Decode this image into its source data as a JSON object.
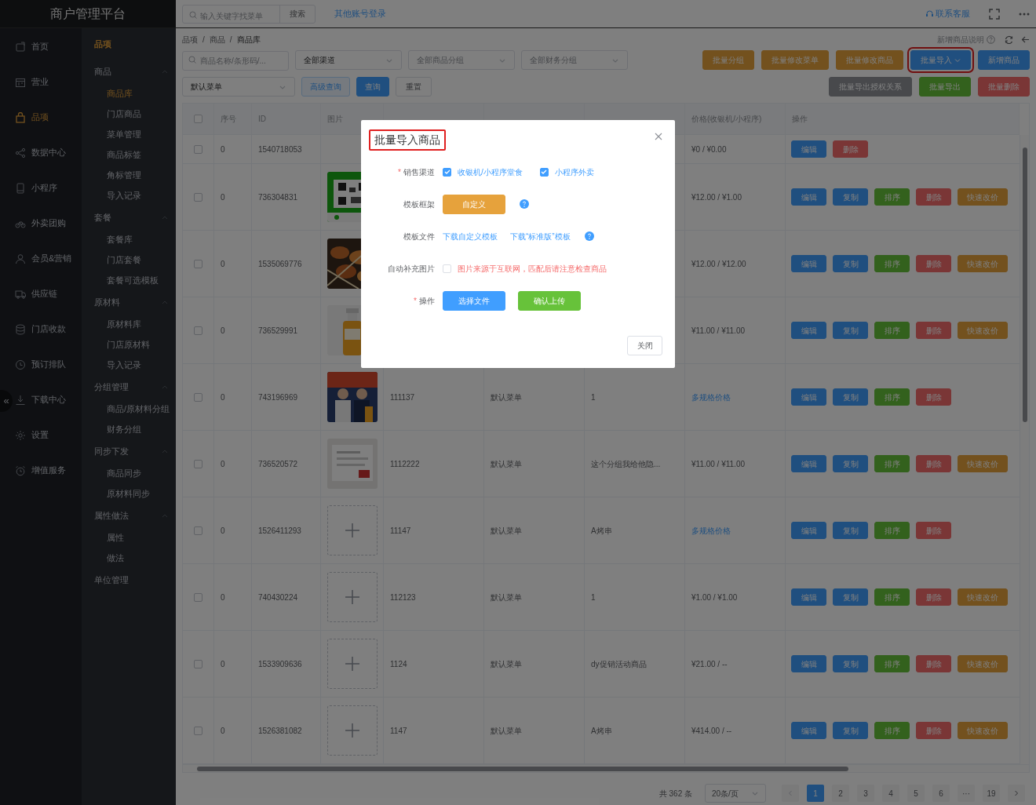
{
  "app_title": "商户管理平台",
  "topbar": {
    "search_placeholder": "输入关键字找菜单",
    "search_button": "搜索",
    "link": "其他账号登录",
    "support": "联系客服"
  },
  "nav": [
    {
      "label": "首页",
      "selected": false
    },
    {
      "label": "营业",
      "selected": false
    },
    {
      "label": "品项",
      "selected": true
    },
    {
      "label": "数据中心",
      "selected": false
    },
    {
      "label": "小程序",
      "selected": false
    },
    {
      "label": "外卖团购",
      "selected": false
    },
    {
      "label": "会员&营销",
      "selected": false
    },
    {
      "label": "供应链",
      "selected": false
    },
    {
      "label": "门店收款",
      "selected": false
    },
    {
      "label": "预订排队",
      "selected": false
    },
    {
      "label": "下载中心",
      "selected": false
    },
    {
      "label": "设置",
      "selected": false
    },
    {
      "label": "增值服务",
      "selected": false
    }
  ],
  "collapse_glyph": "«",
  "subnav": {
    "title": "品项",
    "groups": [
      {
        "kind": "group",
        "label": "商品",
        "expanded": true,
        "children": [
          {
            "label": "商品库",
            "selected": true
          },
          {
            "label": "门店商品",
            "selected": false
          },
          {
            "label": "菜单管理",
            "selected": false
          },
          {
            "label": "商品标签",
            "selected": false
          },
          {
            "label": "角标管理",
            "selected": false
          },
          {
            "label": "导入记录",
            "selected": false
          }
        ]
      },
      {
        "kind": "group",
        "label": "套餐",
        "expanded": true,
        "children": [
          {
            "label": "套餐库",
            "selected": false
          },
          {
            "label": "门店套餐",
            "selected": false
          },
          {
            "label": "套餐可选模板",
            "selected": false
          }
        ]
      },
      {
        "kind": "group",
        "label": "原材料",
        "expanded": true,
        "children": [
          {
            "label": "原材料库",
            "selected": false
          },
          {
            "label": "门店原材料",
            "selected": false
          },
          {
            "label": "导入记录",
            "selected": false
          }
        ]
      },
      {
        "kind": "group",
        "label": "分组管理",
        "expanded": true,
        "children": [
          {
            "label": "商品/原材料分组",
            "selected": false
          },
          {
            "label": "财务分组",
            "selected": false
          }
        ]
      },
      {
        "kind": "group",
        "label": "同步下发",
        "expanded": true,
        "children": [
          {
            "label": "商品同步",
            "selected": false
          },
          {
            "label": "原材料同步",
            "selected": false
          }
        ]
      },
      {
        "kind": "group",
        "label": "属性做法",
        "expanded": true,
        "children": [
          {
            "label": "属性",
            "selected": false
          },
          {
            "label": "做法",
            "selected": false
          }
        ]
      },
      {
        "kind": "link",
        "label": "单位管理"
      }
    ]
  },
  "breadcrumb": [
    "品项",
    "商品",
    "商品库"
  ],
  "breadcrumb_separator": "/",
  "help_link": "新增商品说明",
  "filters": {
    "search_placeholder": "商品名称/条形码/...",
    "selects": [
      {
        "value": "全部渠道"
      },
      {
        "placeholder": "全部商品分组"
      },
      {
        "placeholder": "全部财务分组"
      },
      {
        "value": "默认菜单"
      }
    ],
    "buttons": [
      {
        "label": "高级查询",
        "kind": "plain"
      },
      {
        "label": "查询",
        "kind": "primary"
      },
      {
        "label": "重置",
        "kind": "default"
      }
    ]
  },
  "toolbar": {
    "row1": [
      {
        "label": "批量分组",
        "kind": "warning",
        "highlighted": false,
        "dropdown": false
      },
      {
        "label": "批量修改菜单",
        "kind": "warning",
        "highlighted": false,
        "dropdown": false
      },
      {
        "label": "批量修改商品",
        "kind": "warning",
        "highlighted": false,
        "dropdown": false
      },
      {
        "label": "批量导入",
        "kind": "primary",
        "highlighted": true,
        "dropdown": true
      },
      {
        "label": "新增商品",
        "kind": "primary",
        "highlighted": false,
        "dropdown": false
      }
    ],
    "row2": [
      {
        "label": "批量导出授权关系",
        "kind": "info",
        "highlighted": false,
        "dropdown": false
      },
      {
        "label": "批量导出",
        "kind": "success",
        "highlighted": false,
        "dropdown": false
      },
      {
        "label": "批量删除",
        "kind": "danger",
        "highlighted": false,
        "dropdown": false
      }
    ]
  },
  "table": {
    "header_checked": false,
    "columns": [
      "序号",
      "ID",
      "图片",
      "价格(收银机/小程序)",
      "操作"
    ],
    "rows": [
      {
        "checked": false,
        "seq": "0",
        "id": "1540718053",
        "price": "¥0 / ¥0.00",
        "price_is_link": false,
        "actions": [
          {
            "label": "编辑",
            "kind": "primary"
          },
          {
            "label": "删除",
            "kind": "danger"
          }
        ]
      },
      {
        "checked": false,
        "seq": "0",
        "id": "736304831",
        "image": {
          "kind": "picture"
        },
        "price": "¥12.00 / ¥1.00",
        "price_is_link": false,
        "actions": [
          {
            "label": "编辑",
            "kind": "primary"
          },
          {
            "label": "复制",
            "kind": "primary"
          },
          {
            "label": "排序",
            "kind": "success"
          },
          {
            "label": "删除",
            "kind": "danger"
          },
          {
            "label": "快速改价",
            "kind": "warning"
          }
        ]
      },
      {
        "checked": false,
        "seq": "0",
        "id": "1535069776",
        "image": {
          "kind": "picture"
        },
        "price": "¥12.00 / ¥12.00",
        "price_is_link": false,
        "actions": [
          {
            "label": "编辑",
            "kind": "primary"
          },
          {
            "label": "复制",
            "kind": "primary"
          },
          {
            "label": "排序",
            "kind": "success"
          },
          {
            "label": "删除",
            "kind": "danger"
          },
          {
            "label": "快速改价",
            "kind": "warning"
          }
        ]
      },
      {
        "checked": false,
        "seq": "0",
        "id": "736529991",
        "image": {
          "kind": "picture"
        },
        "price": "¥11.00 / ¥11.00",
        "price_is_link": false,
        "actions": [
          {
            "label": "编辑",
            "kind": "primary"
          },
          {
            "label": "复制",
            "kind": "primary"
          },
          {
            "label": "排序",
            "kind": "success"
          },
          {
            "label": "删除",
            "kind": "danger"
          },
          {
            "label": "快速改价",
            "kind": "warning"
          }
        ]
      },
      {
        "checked": false,
        "seq": "0",
        "id": "743196969",
        "image": {
          "kind": "picture"
        },
        "name": "111137",
        "menu": "默认菜单",
        "group": "1",
        "price": "多规格价格",
        "price_is_link": true,
        "actions": [
          {
            "label": "编辑",
            "kind": "primary"
          },
          {
            "label": "复制",
            "kind": "primary"
          },
          {
            "label": "排序",
            "kind": "success"
          },
          {
            "label": "删除",
            "kind": "danger"
          }
        ]
      },
      {
        "checked": false,
        "seq": "0",
        "id": "736520572",
        "image": {
          "kind": "picture"
        },
        "name": "1112222",
        "menu": "默认菜单",
        "group": "这个分组我给他隐...",
        "price": "¥11.00 / ¥11.00",
        "price_is_link": false,
        "actions": [
          {
            "label": "编辑",
            "kind": "primary"
          },
          {
            "label": "复制",
            "kind": "primary"
          },
          {
            "label": "排序",
            "kind": "success"
          },
          {
            "label": "删除",
            "kind": "danger"
          },
          {
            "label": "快速改价",
            "kind": "warning"
          }
        ]
      },
      {
        "checked": false,
        "seq": "0",
        "id": "1526411293",
        "image": {
          "kind": "placeholder"
        },
        "name": "11147",
        "menu": "默认菜单",
        "group": "A烤串",
        "price": "多规格价格",
        "price_is_link": true,
        "actions": [
          {
            "label": "编辑",
            "kind": "primary"
          },
          {
            "label": "复制",
            "kind": "primary"
          },
          {
            "label": "排序",
            "kind": "success"
          },
          {
            "label": "删除",
            "kind": "danger"
          }
        ]
      },
      {
        "checked": false,
        "seq": "0",
        "id": "740430224",
        "image": {
          "kind": "placeholder"
        },
        "name": "112123",
        "menu": "默认菜单",
        "group": "1",
        "price": "¥1.00 / ¥1.00",
        "price_is_link": false,
        "actions": [
          {
            "label": "编辑",
            "kind": "primary"
          },
          {
            "label": "复制",
            "kind": "primary"
          },
          {
            "label": "排序",
            "kind": "success"
          },
          {
            "label": "删除",
            "kind": "danger"
          },
          {
            "label": "快速改价",
            "kind": "warning"
          }
        ]
      },
      {
        "checked": false,
        "seq": "0",
        "id": "1533909636",
        "image": {
          "kind": "placeholder"
        },
        "name": "1124",
        "menu": "默认菜单",
        "group": "dy促销活动商品",
        "price": "¥21.00 / --",
        "price_is_link": false,
        "actions": [
          {
            "label": "编辑",
            "kind": "primary"
          },
          {
            "label": "复制",
            "kind": "primary"
          },
          {
            "label": "排序",
            "kind": "success"
          },
          {
            "label": "删除",
            "kind": "danger"
          },
          {
            "label": "快速改价",
            "kind": "warning"
          }
        ]
      },
      {
        "checked": false,
        "seq": "0",
        "id": "1526381082",
        "image": {
          "kind": "placeholder"
        },
        "name": "1147",
        "menu": "默认菜单",
        "group": "A烤串",
        "price": "¥414.00 / --",
        "price_is_link": false,
        "actions": [
          {
            "label": "编辑",
            "kind": "primary"
          },
          {
            "label": "复制",
            "kind": "primary"
          },
          {
            "label": "排序",
            "kind": "success"
          },
          {
            "label": "删除",
            "kind": "danger"
          },
          {
            "label": "快速改价",
            "kind": "warning"
          }
        ]
      }
    ]
  },
  "pagination": {
    "total": "共 362 条",
    "page_size": "20条/页",
    "pages": [
      {
        "label": "1",
        "selected": true
      },
      {
        "label": "2",
        "selected": false
      },
      {
        "label": "3",
        "selected": false
      },
      {
        "label": "4",
        "selected": false
      },
      {
        "label": "5",
        "selected": false
      },
      {
        "label": "6",
        "selected": false
      },
      {
        "label": "···",
        "selected": false
      },
      {
        "label": "19",
        "selected": false
      }
    ]
  },
  "modal": {
    "title": "批量导入商品",
    "title_highlighted": true,
    "required_mark": "*",
    "rows": [
      {
        "kind": "checks",
        "label": "销售渠道",
        "required": true,
        "options": [
          {
            "label": "收银机/小程序堂食",
            "checked": true
          },
          {
            "label": "小程序外卖",
            "checked": true
          }
        ]
      },
      {
        "kind": "buttons",
        "label": "模板框架",
        "help": true,
        "buttons": [
          {
            "label": "自定义",
            "kind": "warning"
          }
        ]
      },
      {
        "kind": "links",
        "label": "模板文件",
        "help": true,
        "links": [
          "下载自定义模板",
          "下载“标准版”模板"
        ]
      },
      {
        "kind": "check",
        "label": "自动补充图片",
        "checked": false,
        "note": "图片来源于互联网，匹配后请注意检查商品"
      },
      {
        "kind": "buttons",
        "label": "操作",
        "required": true,
        "buttons": [
          {
            "label": "选择文件",
            "kind": "primary"
          },
          {
            "label": "确认上传",
            "kind": "success"
          }
        ]
      }
    ],
    "close_button": "关闭"
  }
}
